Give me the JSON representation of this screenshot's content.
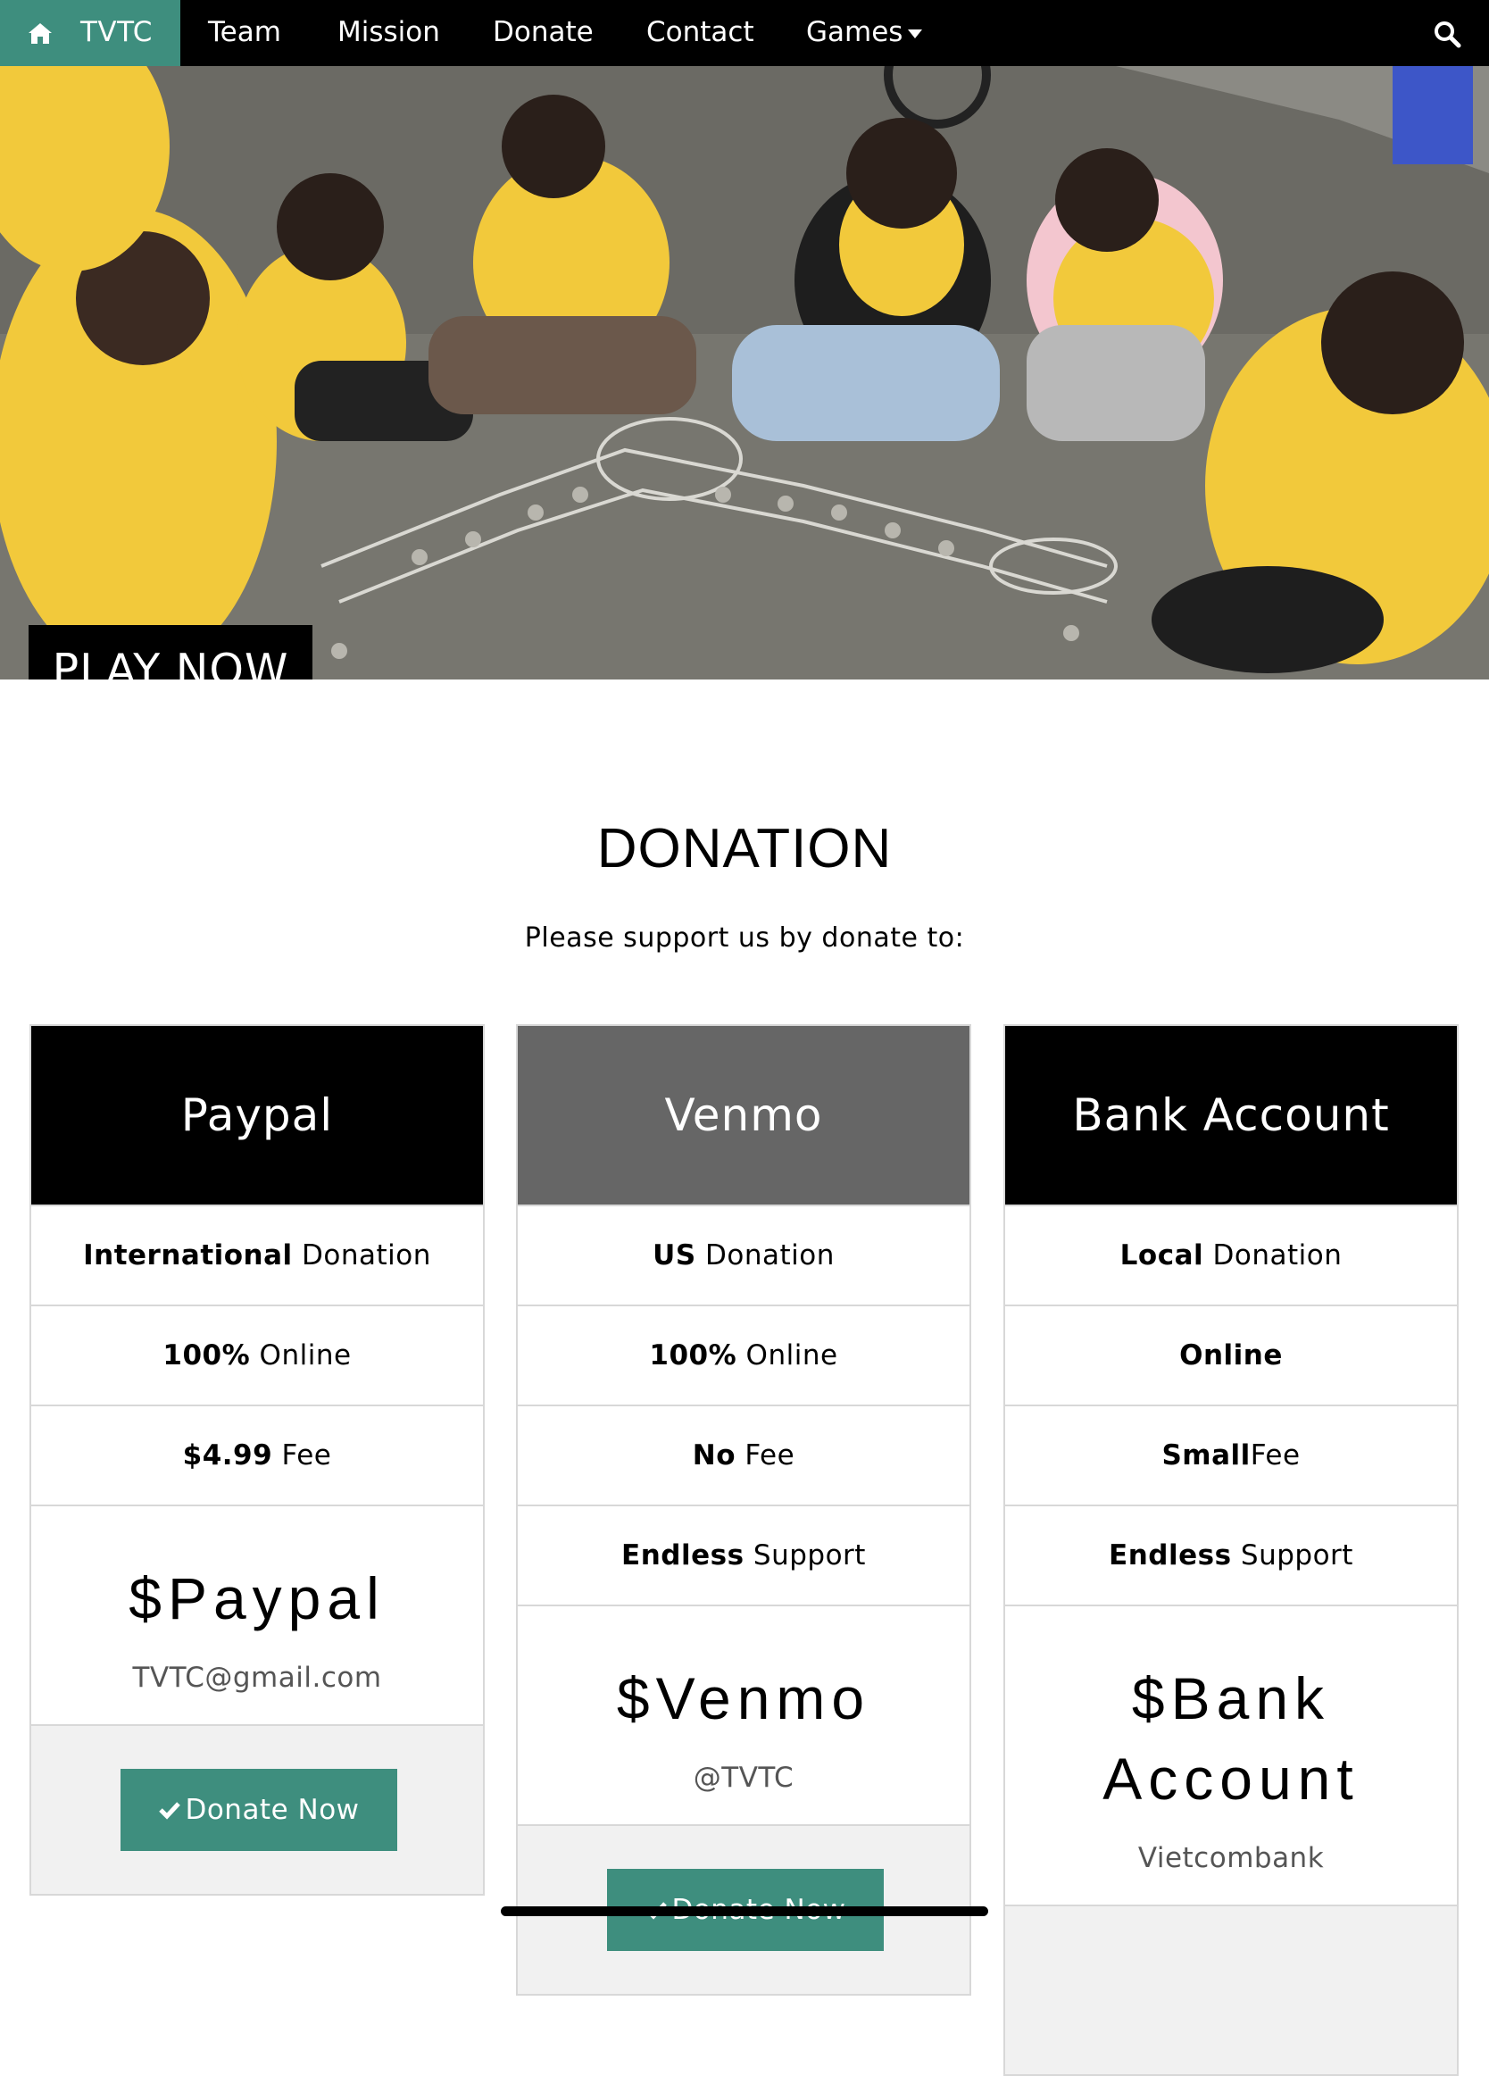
{
  "nav": {
    "brand": "TVTC",
    "brand_icon": "home-icon",
    "links": [
      "Team",
      "Mission",
      "Donate",
      "Contact",
      "Games"
    ],
    "search_icon": "search-icon",
    "accent_color": "#3e8e7e"
  },
  "hero": {
    "play_label": "PLAY NOW"
  },
  "donation": {
    "title": "DONATION",
    "subtitle": "Please support us by donate to:",
    "cards": [
      {
        "name": "Paypal",
        "rows": [
          {
            "bold": "International",
            "text": " Donation"
          },
          {
            "bold": "100%",
            "text": " Online"
          },
          {
            "bold": "$4.99",
            "text": " Fee"
          }
        ],
        "price": "$Paypal",
        "detail": "TVTC@gmail.com",
        "button": "Donate Now"
      },
      {
        "name": "Venmo",
        "rows": [
          {
            "bold": "US",
            "text": " Donation"
          },
          {
            "bold": "100%",
            "text": " Online"
          },
          {
            "bold": "No",
            "text": " Fee"
          },
          {
            "bold": "Endless",
            "text": " Support"
          }
        ],
        "price": "$Venmo",
        "detail": "@TVTC",
        "button": "Donate Now"
      },
      {
        "name": "Bank Account",
        "rows": [
          {
            "bold": "Local",
            "text": " Donation"
          },
          {
            "bold": "Online",
            "text": ""
          },
          {
            "bold": "Small",
            "text": "Fee"
          },
          {
            "bold": "Endless",
            "text": " Support"
          }
        ],
        "price": "$Bank Account",
        "detail": "Vietcombank"
      }
    ]
  }
}
